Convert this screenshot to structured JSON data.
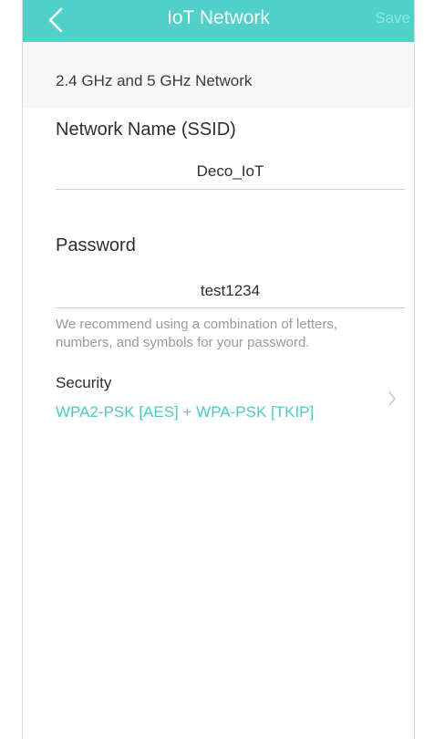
{
  "header": {
    "title": "IoT Network",
    "save_label": "Save"
  },
  "section": {
    "title": "2.4 GHz and 5 GHz Network"
  },
  "ssid": {
    "label": "Network Name (SSID)",
    "value": "Deco_IoT"
  },
  "password": {
    "label": "Password",
    "value": "test1234",
    "hint_line1": "We recommend using a combination of letters,",
    "hint_line2": "numbers, and symbols for your password."
  },
  "security": {
    "label": "Security",
    "value": "WPA2-PSK [AES] + WPA-PSK [TKIP]"
  },
  "colors": {
    "accent": "#4fd1c9",
    "link": "#4cc9c4"
  },
  "icons": {
    "back": "chevron-left-icon",
    "row_arrow": "chevron-right-icon"
  }
}
